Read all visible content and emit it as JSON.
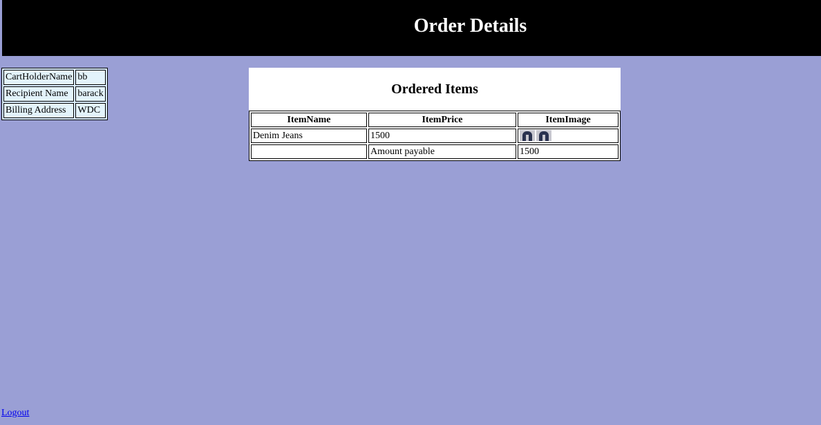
{
  "header": {
    "title": "Order Details"
  },
  "cart_info": {
    "rows": [
      {
        "label": "CartHolderName",
        "value": "bb"
      },
      {
        "label": "Recipient Name",
        "value": "barack"
      },
      {
        "label": "Billing Address",
        "value": "WDC"
      }
    ]
  },
  "ordered_items": {
    "title": "Ordered Items",
    "columns": [
      "ItemName",
      "ItemPrice",
      "ItemImage"
    ],
    "rows": [
      {
        "name": "Denim Jeans",
        "price": "1500",
        "image_icons": [
          "jeans-icon",
          "jeans-icon"
        ]
      }
    ],
    "total": {
      "label": "Amount payable",
      "value": "1500"
    }
  },
  "footer": {
    "logout_label": "Logout"
  }
}
